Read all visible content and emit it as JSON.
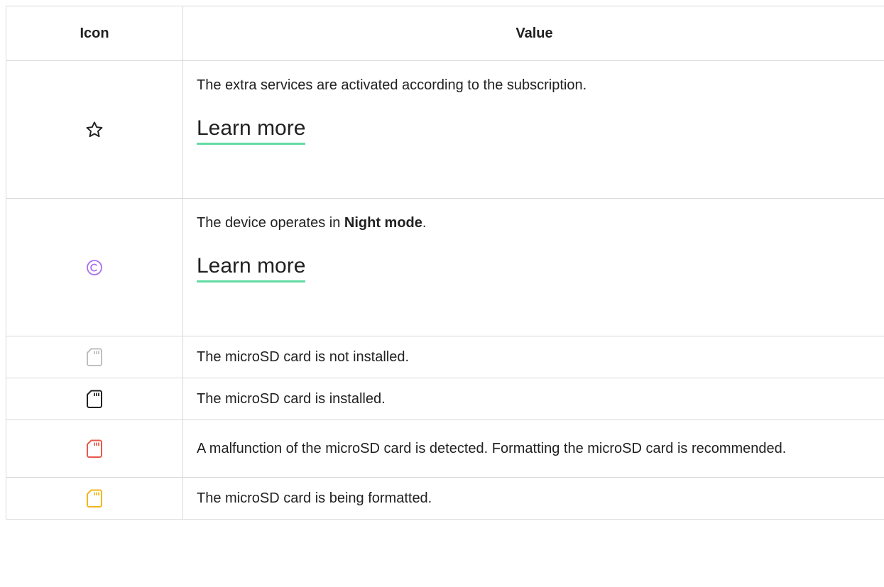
{
  "header": {
    "icon_col": "Icon",
    "value_col": "Value"
  },
  "rows": [
    {
      "icon": "star-outline-icon",
      "icon_color": "#212121",
      "text": "The extra services are activated according to the subscription.",
      "link": "Learn more"
    },
    {
      "icon": "night-mode-icon",
      "icon_color": "#a970f0",
      "text_before": "The device operates in ",
      "text_bold": "Night mode",
      "text_after": ".",
      "link": "Learn more"
    },
    {
      "icon": "microsd-not-installed-icon",
      "icon_color": "#b8b8b8",
      "text": "The microSD card is not installed."
    },
    {
      "icon": "microsd-installed-icon",
      "icon_color": "#212121",
      "text": "The microSD card is installed."
    },
    {
      "icon": "microsd-malfunction-icon",
      "icon_color": "#e8584c",
      "text": "A malfunction of the microSD card is detected. Formatting the microSD card is recommended."
    },
    {
      "icon": "microsd-formatting-icon",
      "icon_color": "#f2b71c",
      "text": "The microSD card is being formatted."
    }
  ],
  "colors": {
    "link_underline": "#61dca3",
    "border": "#d9d9d9",
    "text": "#212121"
  }
}
